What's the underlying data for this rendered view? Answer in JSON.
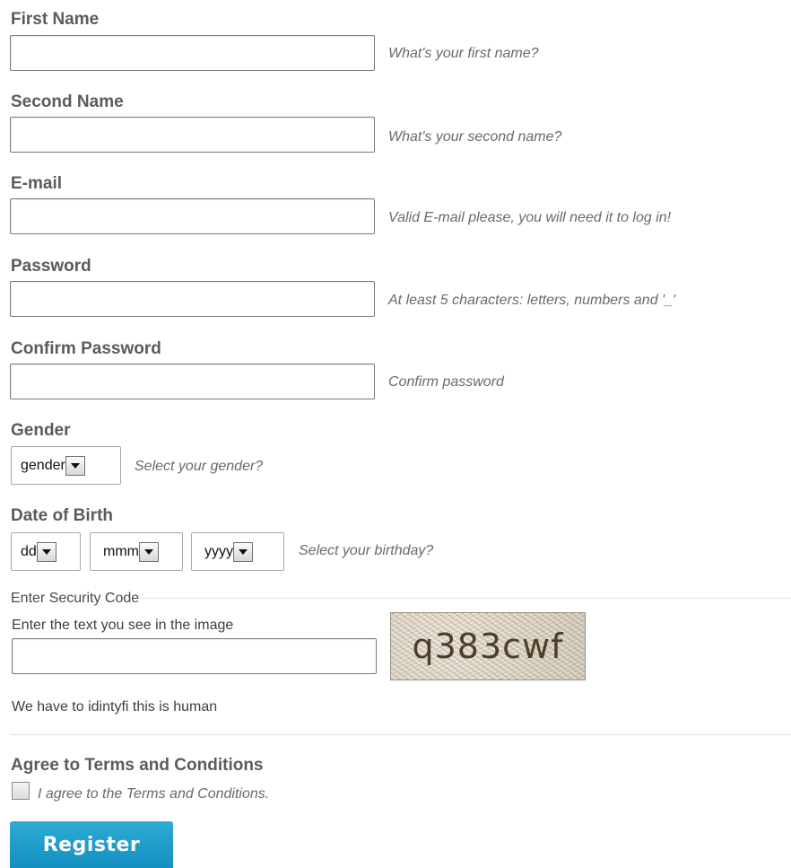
{
  "form": {
    "first_name": {
      "label": "First Name",
      "value": "",
      "hint": "What's your first name?"
    },
    "second_name": {
      "label": "Second Name",
      "value": "",
      "hint": "What's your second name?"
    },
    "email": {
      "label": "E-mail",
      "value": "",
      "hint": "Valid E-mail please, you will need it to log in!"
    },
    "password": {
      "label": "Password",
      "value": "",
      "hint": "At least 5 characters: letters, numbers and '_'"
    },
    "confirm_password": {
      "label": "Confirm Password",
      "value": "",
      "hint": "Confirm password"
    },
    "gender": {
      "label": "Gender",
      "selected": "gender",
      "hint": "Select your gender?"
    },
    "dob": {
      "label": "Date of Birth",
      "day": "dd",
      "month": "mmm",
      "year": "yyyy",
      "hint": "Select your birthday?"
    },
    "security": {
      "legend": "Enter Security Code",
      "instruction": "Enter the text you see in the image",
      "value": "",
      "captcha_text": "q383cwf",
      "note": "We have to idintyfi this is human"
    },
    "terms": {
      "heading": "Agree to Terms and Conditions",
      "checkbox_label": "I agree to the Terms and Conditions.",
      "checked": false
    },
    "register_label": "Register"
  },
  "colors": {
    "label": "#5b5b5b",
    "hint": "#6a6a6a",
    "button": "#1a9bcb",
    "button_text": "#ffffff"
  },
  "icons": {
    "select_arrow": "triangle-down-icon",
    "captcha": "captcha-image"
  }
}
